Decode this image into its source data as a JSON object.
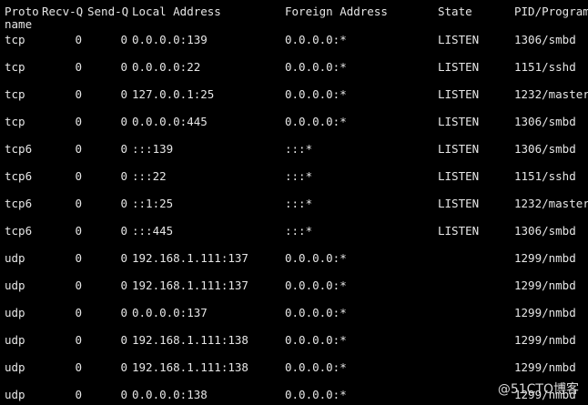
{
  "header": {
    "proto": "Proto",
    "recv_q": "Recv-Q",
    "send_q": "Send-Q",
    "local_address": "Local Address",
    "foreign_address": "Foreign Address",
    "state": "State",
    "pid_program": "PID/Program",
    "name": "name"
  },
  "rows": [
    {
      "proto": "tcp",
      "recv_q": "0",
      "send_q": "0",
      "local": "0.0.0.0:139",
      "foreign": "0.0.0.0:*",
      "state": "LISTEN",
      "pid": "1306/smbd"
    },
    {
      "proto": "tcp",
      "recv_q": "0",
      "send_q": "0",
      "local": "0.0.0.0:22",
      "foreign": "0.0.0.0:*",
      "state": "LISTEN",
      "pid": "1151/sshd"
    },
    {
      "proto": "tcp",
      "recv_q": "0",
      "send_q": "0",
      "local": "127.0.0.1:25",
      "foreign": "0.0.0.0:*",
      "state": "LISTEN",
      "pid": "1232/master"
    },
    {
      "proto": "tcp",
      "recv_q": "0",
      "send_q": "0",
      "local": "0.0.0.0:445",
      "foreign": "0.0.0.0:*",
      "state": "LISTEN",
      "pid": "1306/smbd"
    },
    {
      "proto": "tcp6",
      "recv_q": "0",
      "send_q": "0",
      "local": ":::139",
      "foreign": ":::*",
      "state": "LISTEN",
      "pid": "1306/smbd"
    },
    {
      "proto": "tcp6",
      "recv_q": "0",
      "send_q": "0",
      "local": ":::22",
      "foreign": ":::*",
      "state": "LISTEN",
      "pid": "1151/sshd"
    },
    {
      "proto": "tcp6",
      "recv_q": "0",
      "send_q": "0",
      "local": "::1:25",
      "foreign": ":::*",
      "state": "LISTEN",
      "pid": "1232/master"
    },
    {
      "proto": "tcp6",
      "recv_q": "0",
      "send_q": "0",
      "local": ":::445",
      "foreign": ":::*",
      "state": "LISTEN",
      "pid": "1306/smbd"
    },
    {
      "proto": "udp",
      "recv_q": "0",
      "send_q": "0",
      "local": "192.168.1.111:137",
      "foreign": "0.0.0.0:*",
      "state": "",
      "pid": "1299/nmbd"
    },
    {
      "proto": "udp",
      "recv_q": "0",
      "send_q": "0",
      "local": "192.168.1.111:137",
      "foreign": "0.0.0.0:*",
      "state": "",
      "pid": "1299/nmbd"
    },
    {
      "proto": "udp",
      "recv_q": "0",
      "send_q": "0",
      "local": "0.0.0.0:137",
      "foreign": "0.0.0.0:*",
      "state": "",
      "pid": "1299/nmbd"
    },
    {
      "proto": "udp",
      "recv_q": "0",
      "send_q": "0",
      "local": "192.168.1.111:138",
      "foreign": "0.0.0.0:*",
      "state": "",
      "pid": "1299/nmbd"
    },
    {
      "proto": "udp",
      "recv_q": "0",
      "send_q": "0",
      "local": "192.168.1.111:138",
      "foreign": "0.0.0.0:*",
      "state": "",
      "pid": "1299/nmbd"
    },
    {
      "proto": "udp",
      "recv_q": "0",
      "send_q": "0",
      "local": "0.0.0.0:138",
      "foreign": "0.0.0.0:*",
      "state": "",
      "pid": "1299/nmbd"
    }
  ],
  "watermark": "@51CTO博客",
  "colors": {
    "background": "#000000",
    "text": "#e6e6e6"
  }
}
